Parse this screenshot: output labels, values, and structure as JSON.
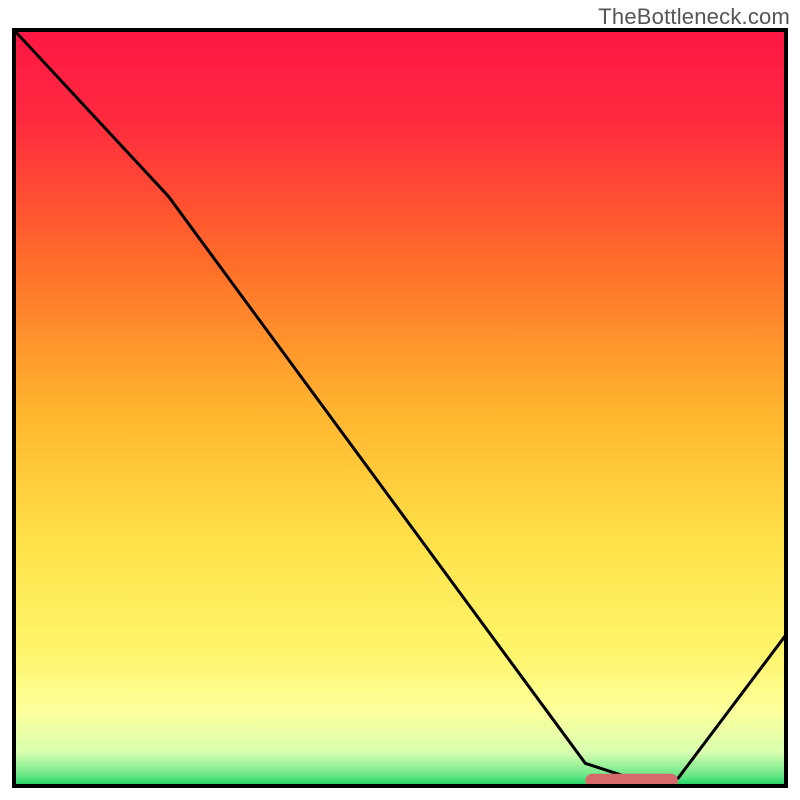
{
  "watermark": "TheBottleneck.com",
  "chart_data": {
    "type": "line",
    "title": "",
    "xlabel": "",
    "ylabel": "",
    "xlim": [
      0,
      100
    ],
    "ylim": [
      0,
      100
    ],
    "grid": false,
    "legend": false,
    "series": [
      {
        "name": "curve",
        "x": [
          0,
          20,
          74,
          80,
          86,
          100
        ],
        "y": [
          100,
          78,
          3,
          1,
          1,
          20
        ]
      }
    ],
    "marker": {
      "x_start": 74,
      "x_end": 86,
      "y": 0.7,
      "color": "#d46a6a"
    },
    "gradient_stops": [
      {
        "offset": 0.0,
        "color": "#ff1744"
      },
      {
        "offset": 0.12,
        "color": "#ff2a3f"
      },
      {
        "offset": 0.3,
        "color": "#ff6a2a"
      },
      {
        "offset": 0.5,
        "color": "#ffb42e"
      },
      {
        "offset": 0.68,
        "color": "#ffe24a"
      },
      {
        "offset": 0.82,
        "color": "#fff56a"
      },
      {
        "offset": 0.9,
        "color": "#fdff9a"
      },
      {
        "offset": 0.955,
        "color": "#d9ffb0"
      },
      {
        "offset": 0.985,
        "color": "#6fe88a"
      },
      {
        "offset": 1.0,
        "color": "#18d060"
      }
    ]
  }
}
